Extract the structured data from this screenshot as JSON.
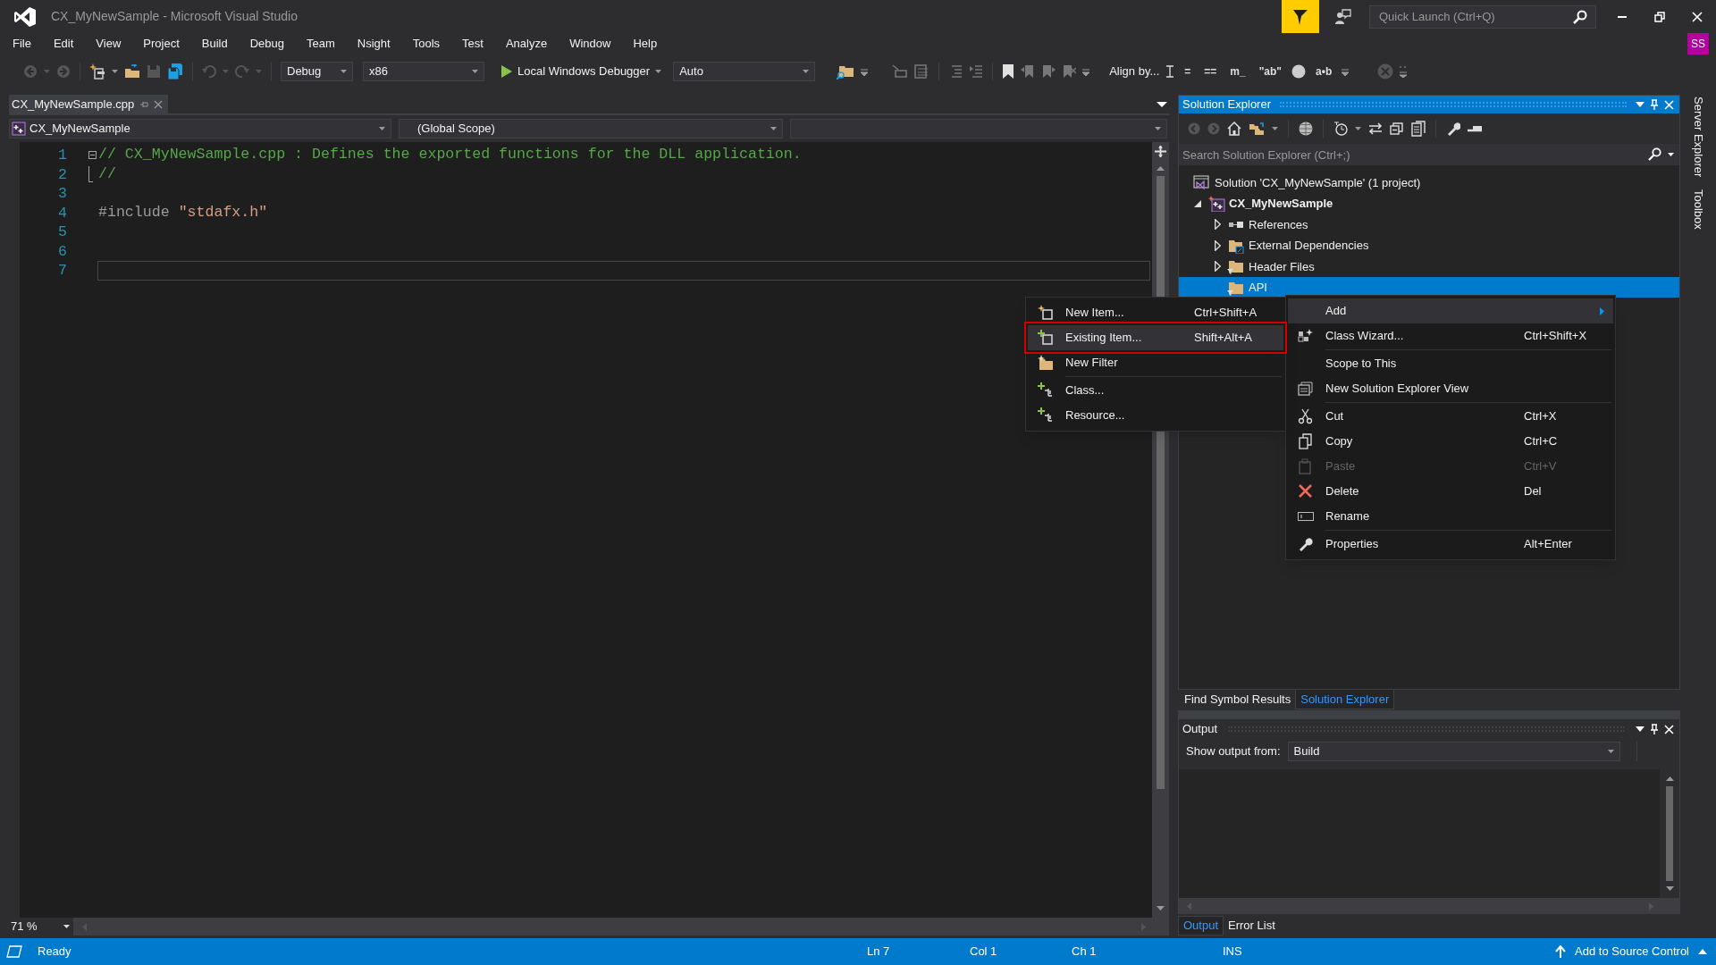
{
  "window": {
    "title": "CX_MyNewSample - Microsoft Visual Studio"
  },
  "quick_launch": {
    "placeholder": "Quick Launch (Ctrl+Q)"
  },
  "account": {
    "initials": "SS"
  },
  "menu": [
    "File",
    "Edit",
    "View",
    "Project",
    "Build",
    "Debug",
    "Team",
    "Nsight",
    "Tools",
    "Test",
    "Analyze",
    "Window",
    "Help"
  ],
  "toolbar": {
    "configuration": "Debug",
    "platform": "x86",
    "debugger": "Local Windows Debugger",
    "target": "Auto",
    "align_label": "Align by...",
    "glyph_buttons": [
      "=",
      "==",
      "m_",
      "\"ab\"",
      "a•b"
    ]
  },
  "document_tabs": [
    {
      "label": "CX_MyNewSample.cpp",
      "selected": true
    }
  ],
  "navigation": {
    "project": "CX_MyNewSample",
    "scope": "(Global Scope)"
  },
  "editor": {
    "lines": [
      {
        "number": "1",
        "fold_start": true,
        "fold_end": false,
        "current": false,
        "tokens": [
          {
            "kind": "comment",
            "text": "// CX_MyNewSample.cpp : Defines the exported functions for the DLL application."
          }
        ]
      },
      {
        "number": "2",
        "fold_start": false,
        "fold_end": true,
        "current": false,
        "tokens": [
          {
            "kind": "comment",
            "text": "//"
          }
        ]
      },
      {
        "number": "3",
        "fold_start": false,
        "fold_end": false,
        "current": false
      },
      {
        "number": "4",
        "fold_start": false,
        "fold_end": false,
        "current": false,
        "tokens": [
          {
            "kind": "preprocessor",
            "text": "#include "
          },
          {
            "kind": "string",
            "text": "\"stdafx.h\""
          }
        ]
      },
      {
        "number": "5",
        "fold_start": false,
        "fold_end": false,
        "current": false
      },
      {
        "number": "6",
        "fold_start": false,
        "fold_end": false,
        "current": false
      },
      {
        "number": "7",
        "fold_start": false,
        "fold_end": false,
        "current": true
      }
    ],
    "zoom": "71 %"
  },
  "solution_explorer": {
    "title": "Solution Explorer",
    "search": {
      "placeholder": "Search Solution Explorer (Ctrl+;)"
    },
    "tree": [
      {
        "label": "Solution 'CX_MyNewSample' (1 project)",
        "kind": "solution",
        "selected": false,
        "children": [
          {
            "label": "CX_MyNewSample",
            "kind": "project",
            "expanded": true,
            "selected": false,
            "children": [
              {
                "label": "References",
                "kind": "references",
                "expanded": false,
                "selected": false
              },
              {
                "label": "External Dependencies",
                "kind": "dependencies",
                "expanded": false,
                "selected": false
              },
              {
                "label": "Header Files",
                "kind": "filter",
                "expanded": false,
                "selected": false
              },
              {
                "label": "API",
                "kind": "filter",
                "selected": true
              }
            ]
          }
        ]
      }
    ]
  },
  "panel_tabs": [
    {
      "label": "Find Symbol Results",
      "selected": false
    },
    {
      "label": "Solution Explorer",
      "selected": true
    }
  ],
  "output": {
    "title": "Output",
    "source_label": "Show output from:",
    "source": "Build"
  },
  "output_tabs": [
    {
      "label": "Output",
      "selected": true
    },
    {
      "label": "Error List",
      "selected": false
    }
  ],
  "side_tabs": [
    "Server Explorer",
    "Toolbox"
  ],
  "status_bar": {
    "state": "Ready",
    "line": "Ln 7",
    "column": "Col 1",
    "character": "Ch 1",
    "mode": "INS",
    "source_control": "Add to Source Control"
  },
  "context_menu": {
    "items": [
      {
        "kind": "submenu",
        "label": "Add",
        "selected": true,
        "disabled": false,
        "submenu": [
          {
            "kind": "command",
            "label": "New Item...",
            "shortcut": "Ctrl+Shift+A",
            "selected": false,
            "marked": false
          },
          {
            "kind": "command",
            "label": "Existing Item...",
            "shortcut": "Shift+Alt+A",
            "selected": true,
            "marked": true
          },
          {
            "kind": "command",
            "label": "New Filter",
            "selected": false,
            "marked": false
          },
          {
            "kind": "separator"
          },
          {
            "kind": "command",
            "label": "Class...",
            "selected": false,
            "marked": false
          },
          {
            "kind": "command",
            "label": "Resource...",
            "selected": false,
            "marked": false
          }
        ]
      },
      {
        "kind": "command",
        "label": "Class Wizard...",
        "shortcut": "Ctrl+Shift+X",
        "selected": false,
        "disabled": false
      },
      {
        "kind": "separator"
      },
      {
        "kind": "command",
        "label": "Scope to This",
        "selected": false,
        "disabled": false
      },
      {
        "kind": "command",
        "label": "New Solution Explorer View",
        "selected": false,
        "disabled": false
      },
      {
        "kind": "separator"
      },
      {
        "kind": "command",
        "label": "Cut",
        "shortcut": "Ctrl+X",
        "selected": false,
        "disabled": false
      },
      {
        "kind": "command",
        "label": "Copy",
        "shortcut": "Ctrl+C",
        "selected": false,
        "disabled": false
      },
      {
        "kind": "command",
        "label": "Paste",
        "shortcut": "Ctrl+V",
        "selected": false,
        "disabled": true
      },
      {
        "kind": "command",
        "label": "Delete",
        "shortcut": "Del",
        "selected": false,
        "disabled": false
      },
      {
        "kind": "command",
        "label": "Rename",
        "selected": false,
        "disabled": false
      },
      {
        "kind": "separator"
      },
      {
        "kind": "command",
        "label": "Properties",
        "shortcut": "Alt+Enter",
        "selected": false,
        "disabled": false
      }
    ]
  }
}
